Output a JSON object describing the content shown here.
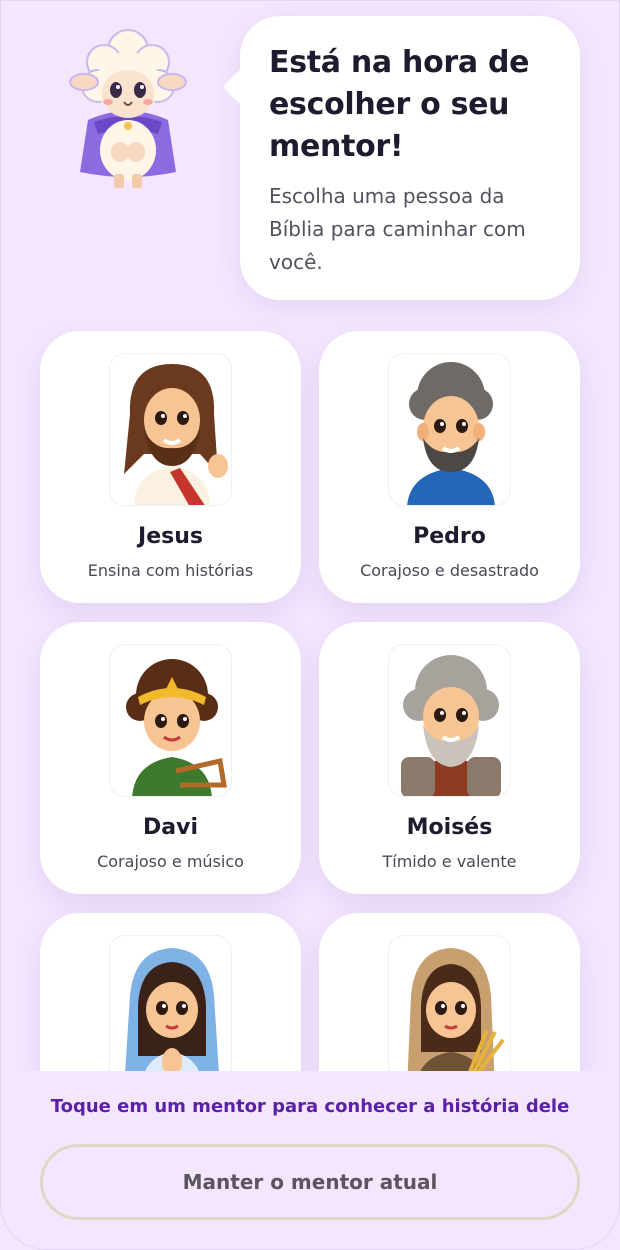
{
  "header": {
    "title": "Está na hora de escolher o seu mentor!",
    "subtitle": "Escolha uma pessoa da Bíblia para caminhar com você."
  },
  "mentors": [
    {
      "name": "Jesus",
      "description": "Ensina com histórias",
      "icon": "jesus-portrait"
    },
    {
      "name": "Pedro",
      "description": "Corajoso e desastrado",
      "icon": "pedro-portrait"
    },
    {
      "name": "Davi",
      "description": "Corajoso e músico",
      "icon": "davi-portrait"
    },
    {
      "name": "Moisés",
      "description": "Tímido e valente",
      "icon": "moises-portrait"
    },
    {
      "name": "",
      "description": "",
      "icon": "maria-portrait"
    },
    {
      "name": "",
      "description": "",
      "icon": "rute-portrait"
    }
  ],
  "footer": {
    "hint": "Toque em um mentor para conhecer a história dele",
    "keep_button": "Manter o mentor atual"
  },
  "colors": {
    "background": "#F3E6FD",
    "accent": "#5B1FA8",
    "card": "#FFFFFF"
  }
}
